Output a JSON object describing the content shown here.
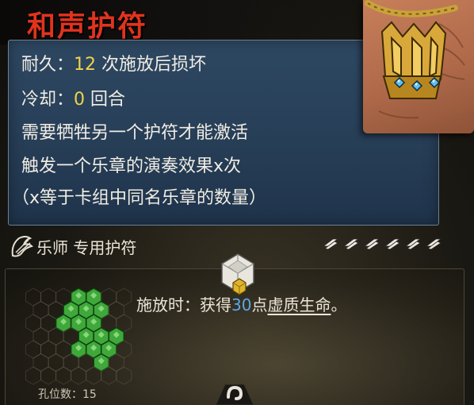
{
  "title": "和声护符",
  "description": {
    "durability_prefix": "耐久：",
    "durability_value": "12",
    "durability_suffix": " 次施放后损坏",
    "cooldown_prefix": "冷却：",
    "cooldown_value": "0",
    "cooldown_suffix": " 回合",
    "line3": "需要牺牲另一个护符才能激活",
    "line4": "触发一个乐章的演奏效果x次",
    "line5": "（x等于卡组中同名乐章的数量）"
  },
  "class_row": {
    "label": "乐师 专用护符",
    "class_icon": "musician-lyre-icon",
    "rarity_pips": 6
  },
  "cast": {
    "prefix": "施放时：获得",
    "amount": "30",
    "mid": "点",
    "keyword": "虚质生命",
    "suffix": "。"
  },
  "slots": {
    "label": "孔位数：15",
    "filled": 15
  },
  "colors": {
    "title": "#e1331e",
    "highlight": "#f0d34a",
    "cast_number": "#5aa8e8",
    "panel_blue": "#2e4862",
    "gem_green": "#3fa83a"
  },
  "icons": {
    "charm": "golden-harmony-charm-icon",
    "cube": "crystal-cube-icon",
    "bottom": "hook-glyph-icon"
  }
}
